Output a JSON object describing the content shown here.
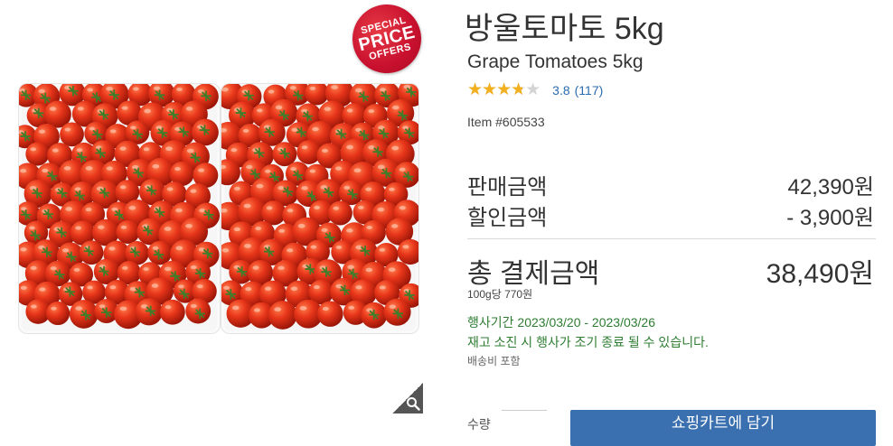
{
  "badge": {
    "line1": "SPECIAL",
    "line2": "PRICE",
    "line3": "OFFERS"
  },
  "icons": {
    "zoom": "magnifier-icon",
    "stars": "star-icon"
  },
  "product": {
    "title_ko": "방울토마토 5kg",
    "title_en": "Grape Tomatoes 5kg",
    "rating_value": 3.8,
    "rating_text": "3.8",
    "review_count": "(117)",
    "item_number": "Item #605533"
  },
  "pricing": {
    "sale_label": "판매금액",
    "sale_value": "42,390원",
    "discount_label": "할인금액",
    "discount_value": "- 3,900원",
    "total_label": "총 결제금액",
    "total_value": "38,490원",
    "unit_price": "100g당 770원"
  },
  "promotion": {
    "period": "행사기간 2023/03/20 - 2023/03/26",
    "note": "재고 소진 시 행사가 조기 종료 될 수 있습니다.",
    "shipping": "배송비 포함"
  },
  "purchase": {
    "quantity_label": "수량",
    "add_to_cart": "쇼핑카트에 담기"
  },
  "colors": {
    "badge": "#c8102e",
    "star": "#f2b01e",
    "link": "#2c6bb0",
    "promo": "#2e7d32",
    "button": "#3a6fb0"
  }
}
